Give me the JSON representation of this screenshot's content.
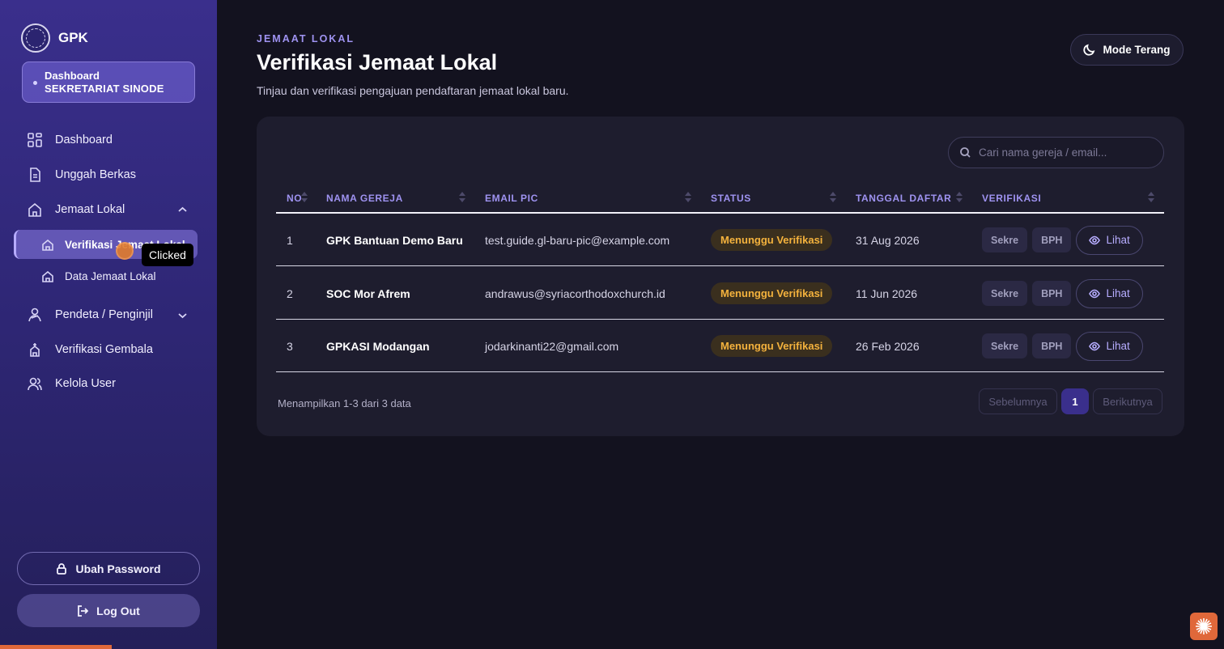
{
  "sidebar": {
    "brand": "GPK",
    "role_title": "Dashboard",
    "role_name": "SEKRETARIAT SINODE",
    "nav": {
      "dashboard": "Dashboard",
      "unggah": "Unggah Berkas",
      "jemaat": "Jemaat Lokal",
      "verifikasi_jemaat": "Verifikasi Jemaat Lokal",
      "data_jemaat": "Data Jemaat Lokal",
      "pendeta": "Pendeta / Penginjil",
      "verifikasi_gembala": "Verifikasi Gembala",
      "kelola": "Kelola User"
    },
    "ubah_password": "Ubah Password",
    "logout": "Log Out"
  },
  "click_indicator": "Clicked",
  "header": {
    "eyebrow": "JEMAAT LOKAL",
    "title": "Verifikasi Jemaat Lokal",
    "subtitle": "Tinjau dan verifikasi pengajuan pendaftaran jemaat lokal baru.",
    "mode_button": "Mode Terang"
  },
  "search": {
    "placeholder": "Cari nama gereja / email..."
  },
  "table": {
    "columns": [
      "NO",
      "NAMA GEREJA",
      "EMAIL PIC",
      "STATUS",
      "TANGGAL DAFTAR",
      "VERIFIKASI"
    ],
    "rows": [
      {
        "no": "1",
        "nama": "GPK Bantuan Demo Baru",
        "email": "test.guide.gl-baru-pic@example.com",
        "status": "Menunggu Verifikasi",
        "tanggal": "31 Aug 2026",
        "sekre": "Sekre",
        "bph": "BPH",
        "lihat": "Lihat"
      },
      {
        "no": "2",
        "nama": "SOC Mor Afrem",
        "email": "andrawus@syriacorthodoxchurch.id",
        "status": "Menunggu Verifikasi",
        "tanggal": "11 Jun 2026",
        "sekre": "Sekre",
        "bph": "BPH",
        "lihat": "Lihat"
      },
      {
        "no": "3",
        "nama": "GPKASI Modangan",
        "email": "jodarkinanti22@gmail.com",
        "status": "Menunggu Verifikasi",
        "tanggal": "26 Feb 2026",
        "sekre": "Sekre",
        "bph": "BPH",
        "lihat": "Lihat"
      }
    ]
  },
  "pagination": {
    "info": "Menampilkan 1-3 dari 3 data",
    "prev": "Sebelumnya",
    "page": "1",
    "next": "Berikutnya"
  },
  "colors": {
    "accent": "#9f93f1",
    "sidebar": "#3a2f8c",
    "badge": "#f4b23d"
  }
}
